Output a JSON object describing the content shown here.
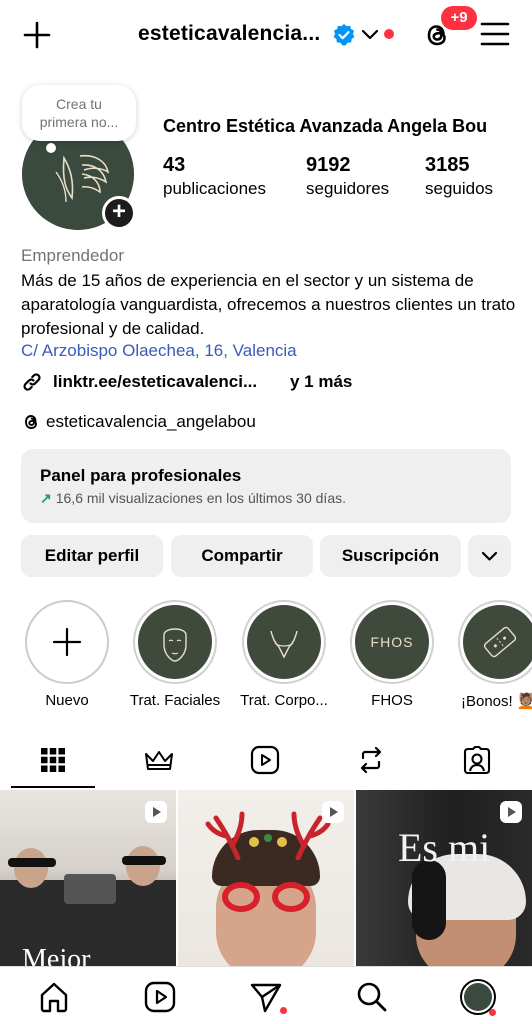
{
  "header": {
    "username": "esteticavalencia...",
    "threads_badge": "+9"
  },
  "profile": {
    "note_placeholder": "Crea tu primera no...",
    "full_name": "Centro Estética Avanzada Angela Bou",
    "stats": [
      {
        "value": "43",
        "label": "publicaciones"
      },
      {
        "value": "9192",
        "label": "seguidores"
      },
      {
        "value": "3185",
        "label": "seguidos"
      }
    ],
    "category": "Emprendedor",
    "bio": "Más de 15 años de experiencia en el sector y un sistema de aparatología vanguardista, ofrecemos a nuestros clientes un trato profesional y de calidad.",
    "address": "C/ Arzobispo Olaechea, 16, Valencia",
    "link": "linktr.ee/esteticavalenci...",
    "link_more": "y 1 más",
    "threads_handle": "esteticavalencia_angelabou"
  },
  "panel": {
    "title": "Panel para profesionales",
    "subtitle": "16,6 mil visualizaciones en los últimos 30 días."
  },
  "actions": {
    "edit": "Editar perfil",
    "share": "Compartir",
    "subscribe": "Suscripción"
  },
  "highlights": [
    {
      "label": "Nuevo"
    },
    {
      "label": "Trat. Faciales"
    },
    {
      "label": "Trat. Corpo..."
    },
    {
      "label": "FHOS",
      "inner_text": "FHOS"
    },
    {
      "label": "¡Bonos! 💆🏽"
    }
  ],
  "grid_posts": [
    {
      "overlay_text": "Mejor"
    },
    {
      "overlay_text": ""
    },
    {
      "overlay_text": "Es mi"
    }
  ],
  "colors": {
    "brand_dark_green": "#3a4a3e",
    "notification_red": "#ff3040",
    "link_blue": "#3a5bb8",
    "verified_blue": "#0095f6",
    "trend_green": "#1aa261"
  }
}
